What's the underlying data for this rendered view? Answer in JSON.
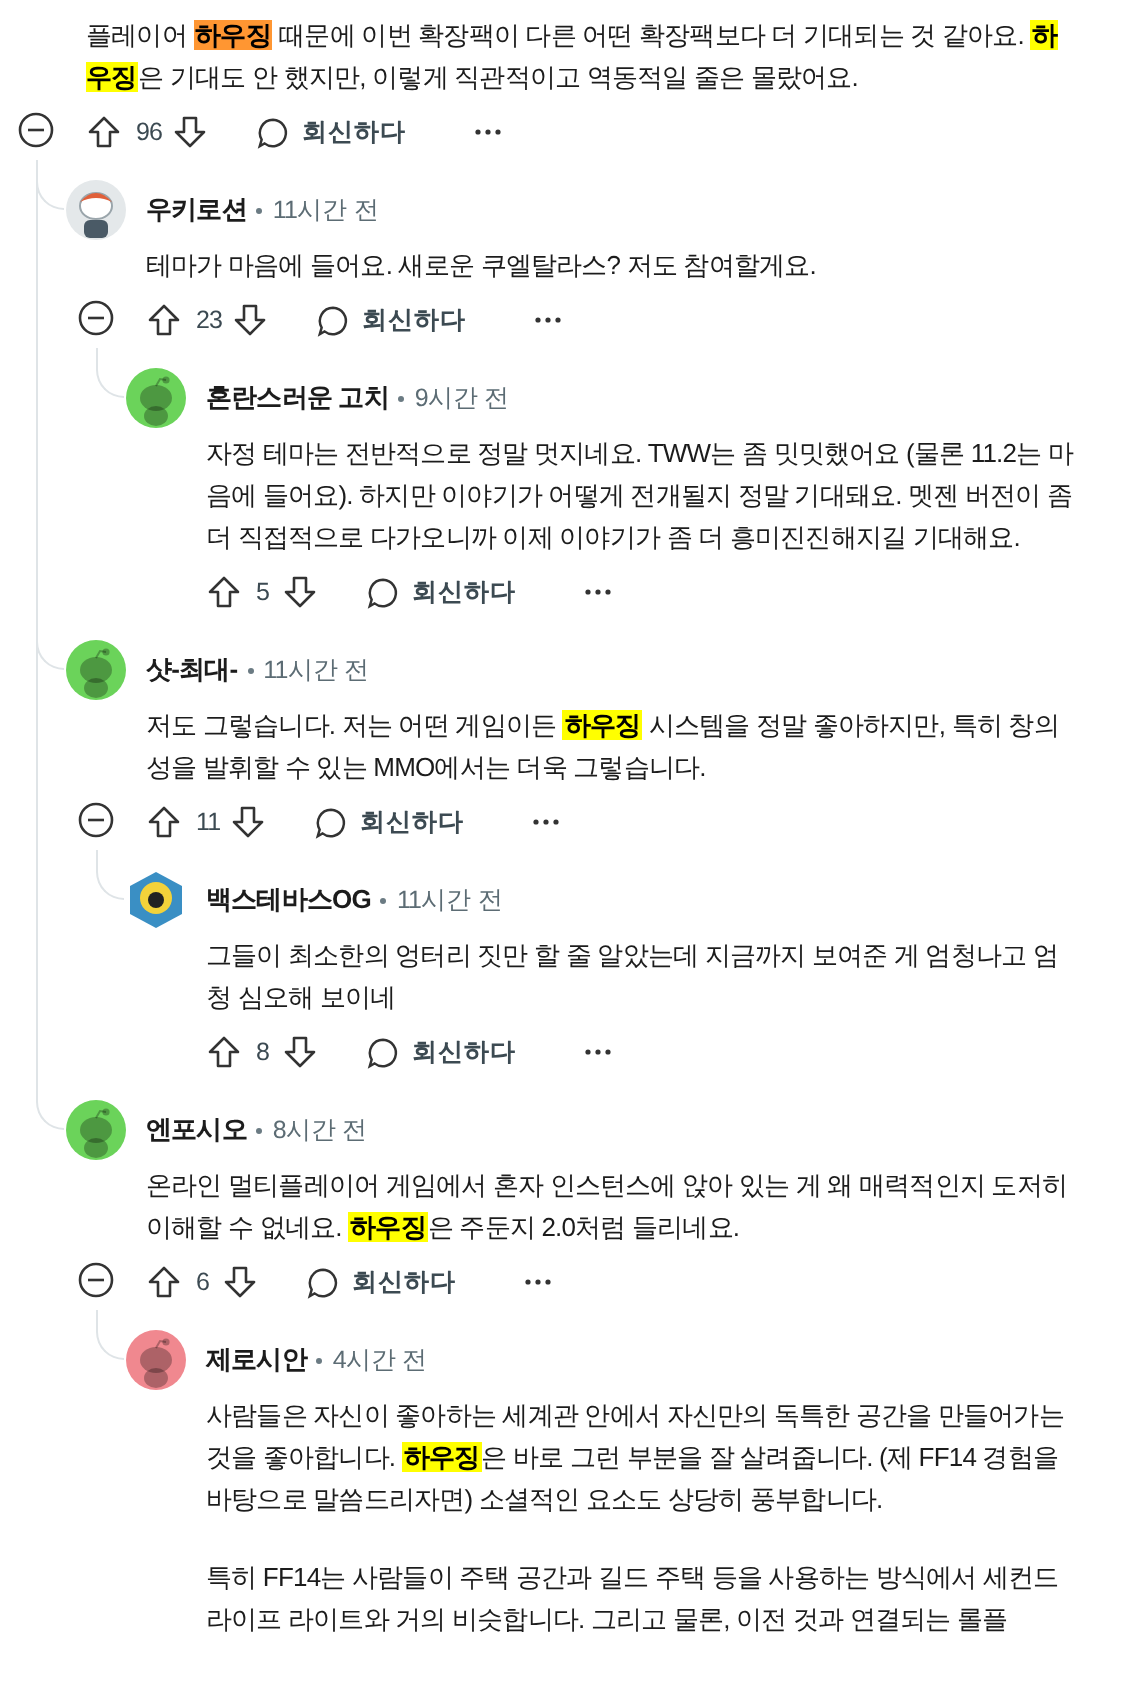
{
  "comments": [
    {
      "body": [
        [
          {
            "text": "플레이어 "
          },
          {
            "text": "하우징",
            "color": "#ff9632"
          },
          {
            "text": " 때문에 이번 확장팩이 다른 어떤 확장팩보다 더 기대되는 것 같아요. "
          },
          {
            "text": "하우징",
            "color": "#ffff00"
          },
          {
            "text": "은 기대도 안 했지만, 이렇게 직관적이고 역동적일 줄은 몰랐어요."
          }
        ]
      ],
      "votes": "96",
      "reply": "회신하다",
      "children": [
        {
          "author": "우키로션",
          "time": "11시간 전",
          "avatar": {
            "kind": "figure"
          },
          "body": [
            [
              {
                "text": "테마가 마음에 들어요. 새로운 쿠엘탈라스? 저도 참여할게요."
              }
            ]
          ],
          "votes": "23",
          "reply": "회신하다",
          "children": [
            {
              "author": "혼란스러운 고치",
              "time": "9시간 전",
              "avatar": {
                "kind": "default",
                "color": "#6bd35a"
              },
              "body": [
                [
                  {
                    "text": "자정 테마는 전반적으로 정말 멋지네요. TWW는 좀 밋밋했어요 (물론 11.2는 마음에 들어요). 하지만 이야기가 어떻게 전개될지 정말 기대돼요. 멧젠 버전이 좀 더 직접적으로 다가오니까 이제 이야기가 좀 더 흥미진진해지길 기대해요."
                  }
                ]
              ],
              "votes": "5",
              "reply": "회신하다"
            }
          ]
        },
        {
          "author": "샷-최대-",
          "time": "11시간 전",
          "avatar": {
            "kind": "default",
            "color": "#6bd35a"
          },
          "body": [
            [
              {
                "text": "저도 그렇습니다. 저는 어떤 게임이든 "
              },
              {
                "text": "하우징",
                "color": "#ffff00"
              },
              {
                "text": " 시스템을 정말 좋아하지만, 특히 창의성을 발휘할 수 있는 MMO에서는 더욱 그렇습니다."
              }
            ]
          ],
          "votes": "11",
          "reply": "회신하다",
          "children": [
            {
              "author": "백스테바스OG",
              "time": "11시간 전",
              "avatar": {
                "kind": "badge"
              },
              "body": [
                [
                  {
                    "text": "그들이 최소한의 엉터리 짓만 할 줄 알았는데 지금까지 보여준 게 엄청나고 엄청 심오해 보이네"
                  }
                ]
              ],
              "votes": "8",
              "reply": "회신하다"
            }
          ]
        },
        {
          "author": "엔포시오",
          "time": "8시간 전",
          "avatar": {
            "kind": "default",
            "color": "#6bd35a"
          },
          "body": [
            [
              {
                "text": "온라인 멀티플레이어 게임에서 혼자 인스턴스에 앉아 있는 게 왜 매력적인지 도저히 이해할 수 없네요. "
              },
              {
                "text": "하우징",
                "color": "#ffff00"
              },
              {
                "text": "은 주둔지 2.0처럼 들리네요."
              }
            ]
          ],
          "votes": "6",
          "reply": "회신하다",
          "children": [
            {
              "author": "제로시안",
              "time": "4시간 전",
              "avatar": {
                "kind": "default",
                "color": "#f0888f"
              },
              "body": [
                [
                  {
                    "text": "사람들은 자신이 좋아하는 세계관 안에서 자신만의 독특한 공간을 만들어가는 것을 좋아합니다. "
                  },
                  {
                    "text": "하우징",
                    "color": "#ffff00"
                  },
                  {
                    "text": "은 바로 그런 부분을 잘 살려줍니다. (제 FF14 경험을 바탕으로 말씀드리자면) 소셜적인 요소도 상당히 풍부합니다."
                  }
                ],
                [
                  {
                    "text": "특히 FF14는 사람들이 주택 공간과 길드 주택 등을 사용하는 방식에서 세컨드 라이프 라이트와 거의 비슷합니다. 그리고 물론, 이전 것과 연결되는 롤플"
                  }
                ]
              ]
            }
          ]
        }
      ]
    }
  ]
}
